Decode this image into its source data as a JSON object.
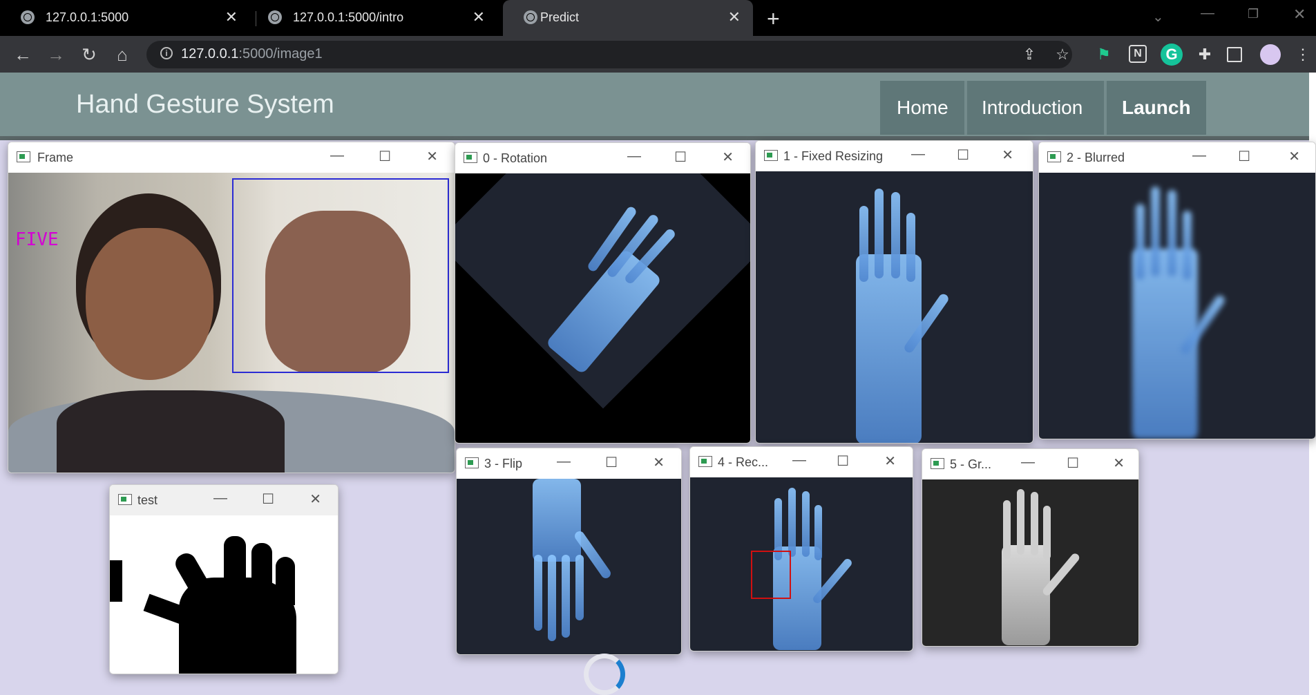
{
  "browser": {
    "tabs": [
      {
        "title": "127.0.0.1:5000",
        "active": false
      },
      {
        "title": "127.0.0.1:5000/intro",
        "active": false
      },
      {
        "title": "Predict",
        "active": true
      }
    ],
    "new_tab": "+",
    "url_host": "127.0.0.1",
    "url_path": ":5000/image1"
  },
  "site": {
    "brand": "Hand Gesture System",
    "nav": [
      "Home",
      "Introduction",
      "Launch"
    ]
  },
  "windows": {
    "frame": {
      "title": "Frame",
      "label": "FIVE"
    },
    "rotation": {
      "title": "0 - Rotation"
    },
    "fixed": {
      "title": "1 - Fixed Resizing"
    },
    "blurred": {
      "title": "2 - Blurred"
    },
    "flip": {
      "title": "3 - Flip"
    },
    "rec": {
      "title": "4 - Rec..."
    },
    "gray": {
      "title": "5 - Gr..."
    },
    "test": {
      "title": "test"
    }
  },
  "glyphs": {
    "minimize": "—",
    "maximize": "☐",
    "close": "✕"
  },
  "colors": {
    "header": "#7b9292",
    "nav_block": "#5f7778",
    "page_bg": "#d8d5ec",
    "gesture_label": "#d400d4"
  }
}
